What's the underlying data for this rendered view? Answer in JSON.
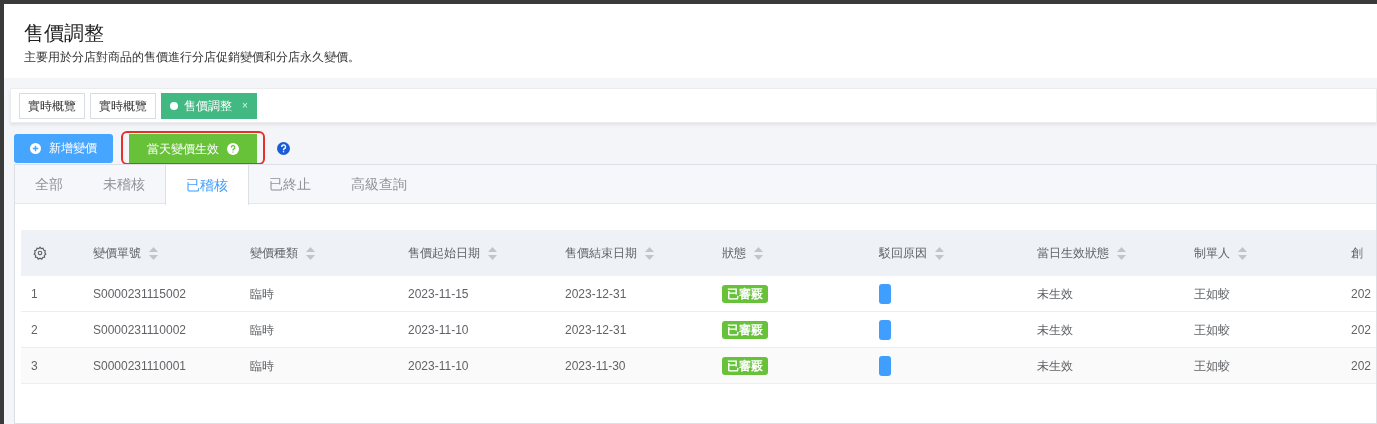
{
  "page": {
    "title": "售價調整",
    "description": "主要用於分店對商品的售價進行分店促銷變價和分店永久變價。"
  },
  "open_tabs": [
    {
      "label": "實時概覽",
      "selected": false
    },
    {
      "label": "實時概覽",
      "selected": false
    },
    {
      "label": "售價調整",
      "selected": true,
      "close": "×"
    }
  ],
  "actions": [
    {
      "kind": "add",
      "label": "新增變價",
      "highlighted": false
    },
    {
      "kind": "apply",
      "label": "當天變價生效",
      "highlighted": true
    }
  ],
  "status_tabs": [
    {
      "label": "全部",
      "selected": false
    },
    {
      "label": "未稽核",
      "selected": false
    },
    {
      "label": "已稽核",
      "selected": true
    },
    {
      "label": "已終止",
      "selected": false
    },
    {
      "label": "高級查詢",
      "selected": false
    }
  ],
  "table": {
    "columns": [
      "變價單號",
      "變價種類",
      "售價起始日期",
      "售價結束日期",
      "狀態",
      "駁回原因",
      "當日生效狀態",
      "制單人",
      "創"
    ],
    "rows": [
      {
        "index": "1",
        "number": "S0000231115002",
        "type": "臨時",
        "start": "2023-11-15",
        "end": "2023-12-31",
        "status": "已審覈",
        "effective": "未生效",
        "creator": "王如蛟",
        "created": "202"
      },
      {
        "index": "2",
        "number": "S0000231110002",
        "type": "臨時",
        "start": "2023-11-10",
        "end": "2023-12-31",
        "status": "已審覈",
        "effective": "未生效",
        "creator": "王如蛟",
        "created": "202"
      },
      {
        "index": "3",
        "number": "S0000231110001",
        "type": "臨時",
        "start": "2023-11-10",
        "end": "2023-11-30",
        "status": "已審覈",
        "effective": "未生效",
        "creator": "王如蛟",
        "created": "202"
      }
    ]
  }
}
